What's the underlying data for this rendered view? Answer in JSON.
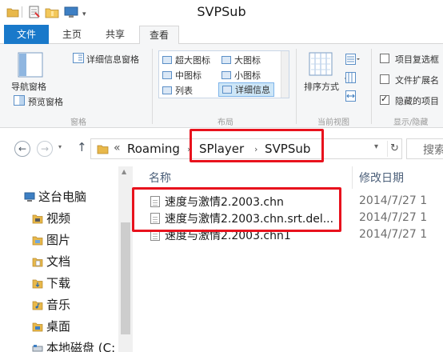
{
  "window": {
    "title": "SVPSub"
  },
  "ribbon_tabs": [
    "文件",
    "主页",
    "共享",
    "查看"
  ],
  "ribbon": {
    "panes": {
      "nav_pane_label": "导航窗格",
      "preview_pane_label": "预览窗格",
      "details_pane_label": "详细信息窗格",
      "group_title": "窗格"
    },
    "layout": {
      "items": [
        "超大图标",
        "大图标",
        "中图标",
        "小图标",
        "列表",
        "详细信息"
      ],
      "group_title": "布局"
    },
    "current_view": {
      "sort_label": "排序方式",
      "group_title": "当前视图"
    },
    "show_hide": {
      "item_checkboxes_label": "项目复选框",
      "item_checkboxes_checked": false,
      "file_extensions_label": "文件扩展名",
      "file_extensions_checked": false,
      "hidden_items_label": "隐藏的项目",
      "hidden_items_checked": true,
      "group_title": "显示/隐藏"
    }
  },
  "address": {
    "crumbs": [
      "Roaming",
      "SPlayer",
      "SVPSub"
    ],
    "overflow": "«",
    "search_placeholder": "搜索"
  },
  "nav_tree": [
    {
      "label": "这台电脑",
      "icon": "computer-icon"
    },
    {
      "label": "视频",
      "icon": "video-folder-icon"
    },
    {
      "label": "图片",
      "icon": "pictures-folder-icon"
    },
    {
      "label": "文档",
      "icon": "documents-folder-icon"
    },
    {
      "label": "下载",
      "icon": "downloads-folder-icon"
    },
    {
      "label": "音乐",
      "icon": "music-folder-icon"
    },
    {
      "label": "桌面",
      "icon": "desktop-folder-icon"
    },
    {
      "label": "本地磁盘 (C:",
      "icon": "local-disk-icon"
    }
  ],
  "file_list": {
    "columns": {
      "name": "名称",
      "date": "修改日期"
    },
    "files": [
      {
        "name": "速度与激情2.2003.chn",
        "date": "2014/7/27 1"
      },
      {
        "name": "速度与激情2.2003.chn.srt.del...",
        "date": "2014/7/27 1"
      },
      {
        "name": "速度与激情2.2003.chn1",
        "date": "2014/7/27 1"
      }
    ]
  },
  "colors": {
    "accent": "#1979ca",
    "highlight": "#e8121d",
    "folder": "#e8b84a"
  }
}
